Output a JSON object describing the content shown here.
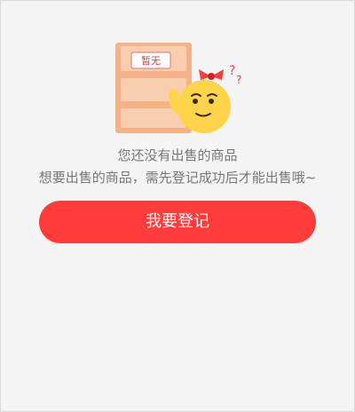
{
  "empty_state": {
    "illustration": {
      "icon": "empty-mascot-icon",
      "badge_text": "暂无"
    },
    "title": "您还没有出售的商品",
    "subtitle": "想要出售的商品，需先登记成功后才能出售哦~",
    "button_label": "我要登记"
  },
  "colors": {
    "background": "#f4f4f4",
    "primary_red": "#ff3b3b",
    "text_gray": "#777777",
    "shelf_orange": "#f3b287",
    "mascot_yellow": "#ffd44b"
  }
}
